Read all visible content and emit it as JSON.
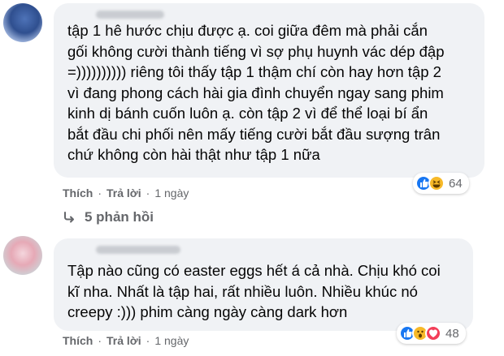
{
  "comments": [
    {
      "text": "tập 1 hê hước      chịu được ạ. coi giữa đêm mà phải cắn\ngối không cười thành tiếng vì sợ phụ huynh vác dép đập\n=)))))))))) riêng tôi thấy tập 1 thậm chí còn hay hơn tập 2\nvì đang phong cách hài gia đình chuyển ngay sang phim\nkinh dị bánh cuốn       luôn ạ. còn tập 2 vì để thể loại bí ẩn\nbắt đầu chi phối nên mấy tiếng cười bắt đầu sượng trân\nchứ không còn hài thật như tập 1 nữa",
      "reaction_icons": [
        "like-icon",
        "haha-icon"
      ],
      "reaction_count": "64",
      "like_label": "Thích",
      "reply_label": "Trả lời",
      "time": "1 ngày",
      "replies_label": "5 phản hồi"
    },
    {
      "text": "Tập nào cũng có easter eggs hết á cả nhà. Chịu khó coi\nkĩ nha. Nhất là tập hai, rất nhiều luôn. Nhiều khúc nó\ncreepy     :))) phim càng ngày càng dark hơn",
      "reaction_icons": [
        "like-icon",
        "wow-icon",
        "love-icon"
      ],
      "reaction_count": "48",
      "like_label": "Thích",
      "reply_label": "Trả lời",
      "time": "1 ngày"
    }
  ],
  "separator": "·",
  "colors": {
    "bubble": "#f0f2f5",
    "meta": "#65676b",
    "like": "#1877f2",
    "love": "#f33e58",
    "emoji": "#f7b928"
  }
}
